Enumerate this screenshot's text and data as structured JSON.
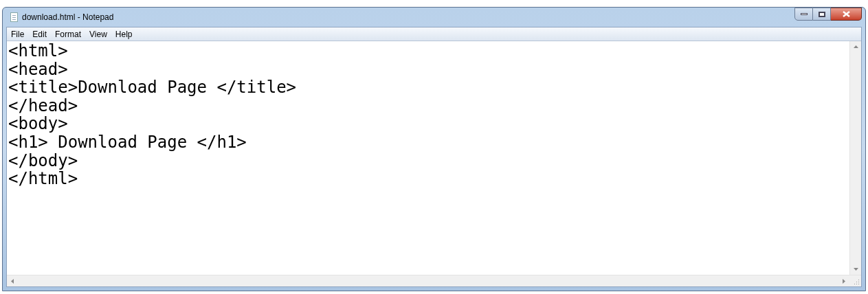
{
  "window": {
    "title": "download.html - Notepad"
  },
  "menu": [
    "File",
    "Edit",
    "Format",
    "View",
    "Help"
  ],
  "editor": {
    "lines": [
      "<html>",
      "<head>",
      "<title>Download Page </title>",
      "</head>",
      "<body>",
      "<h1> Download Page </h1>",
      "</body>",
      "</html>"
    ]
  }
}
